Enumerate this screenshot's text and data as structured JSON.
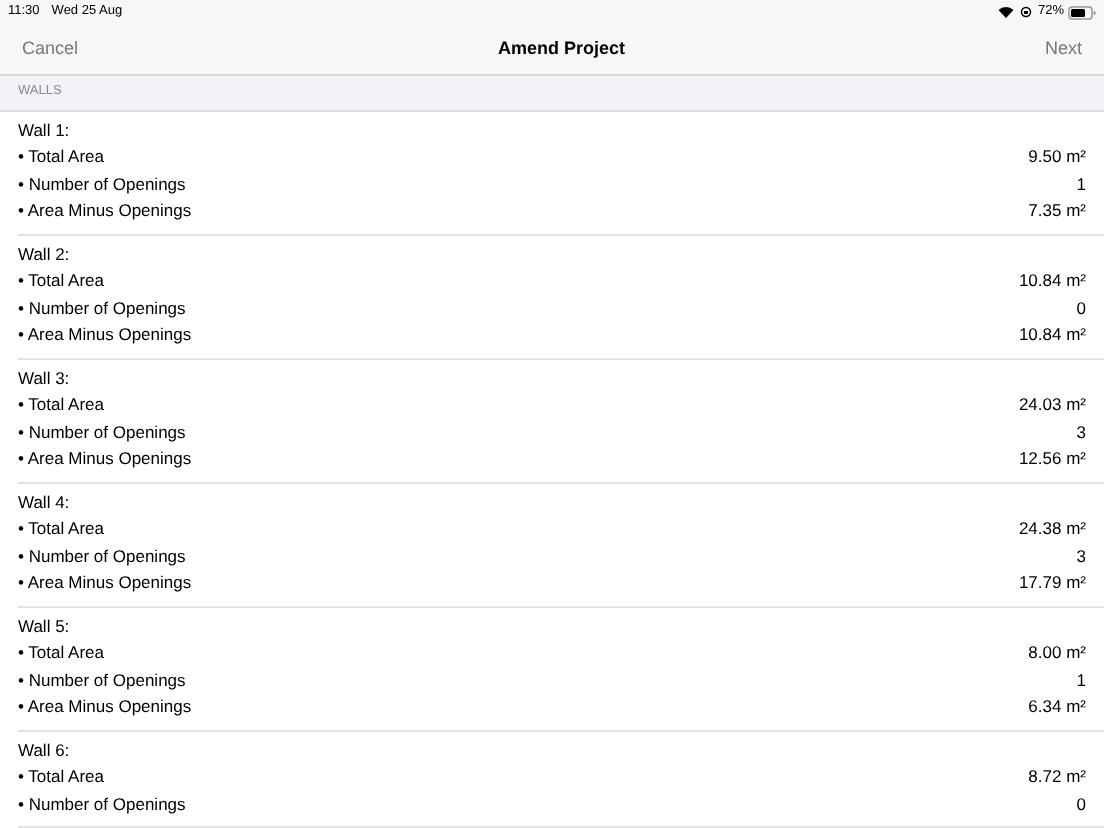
{
  "status_bar": {
    "time": "11:30",
    "date": "Wed 25 Aug",
    "battery": "72%"
  },
  "nav_bar": {
    "left": "Cancel",
    "title": "Amend Project",
    "right": "Next"
  },
  "section": {
    "title": "WALLS"
  },
  "walls": [
    {
      "title": "Wall 1:",
      "rows": [
        {
          "label": "• Total Area",
          "value": "9.50 m²"
        },
        {
          "label": "• Number of Openings",
          "value": "1"
        },
        {
          "label": "• Area Minus Openings",
          "value": "7.35 m²"
        }
      ]
    },
    {
      "title": "Wall 2:",
      "rows": [
        {
          "label": "• Total Area",
          "value": "10.84 m²"
        },
        {
          "label": "• Number of Openings",
          "value": "0"
        },
        {
          "label": "• Area Minus Openings",
          "value": "10.84 m²"
        }
      ]
    },
    {
      "title": "Wall 3:",
      "rows": [
        {
          "label": "• Total Area",
          "value": "24.03 m²"
        },
        {
          "label": "• Number of Openings",
          "value": "3"
        },
        {
          "label": "• Area Minus Openings",
          "value": "12.56 m²"
        }
      ]
    },
    {
      "title": "Wall 4:",
      "rows": [
        {
          "label": "• Total Area",
          "value": "24.38 m²"
        },
        {
          "label": "• Number of Openings",
          "value": "3"
        },
        {
          "label": "• Area Minus Openings",
          "value": "17.79 m²"
        }
      ]
    },
    {
      "title": "Wall 5:",
      "rows": [
        {
          "label": "• Total Area",
          "value": "8.00 m²"
        },
        {
          "label": "• Number of Openings",
          "value": "1"
        },
        {
          "label": "• Area Minus Openings",
          "value": "6.34 m²"
        }
      ]
    },
    {
      "title": "Wall 6:",
      "rows": [
        {
          "label": "• Total Area",
          "value": "8.72 m²"
        },
        {
          "label": "• Number of Openings",
          "value": "0"
        }
      ]
    }
  ]
}
